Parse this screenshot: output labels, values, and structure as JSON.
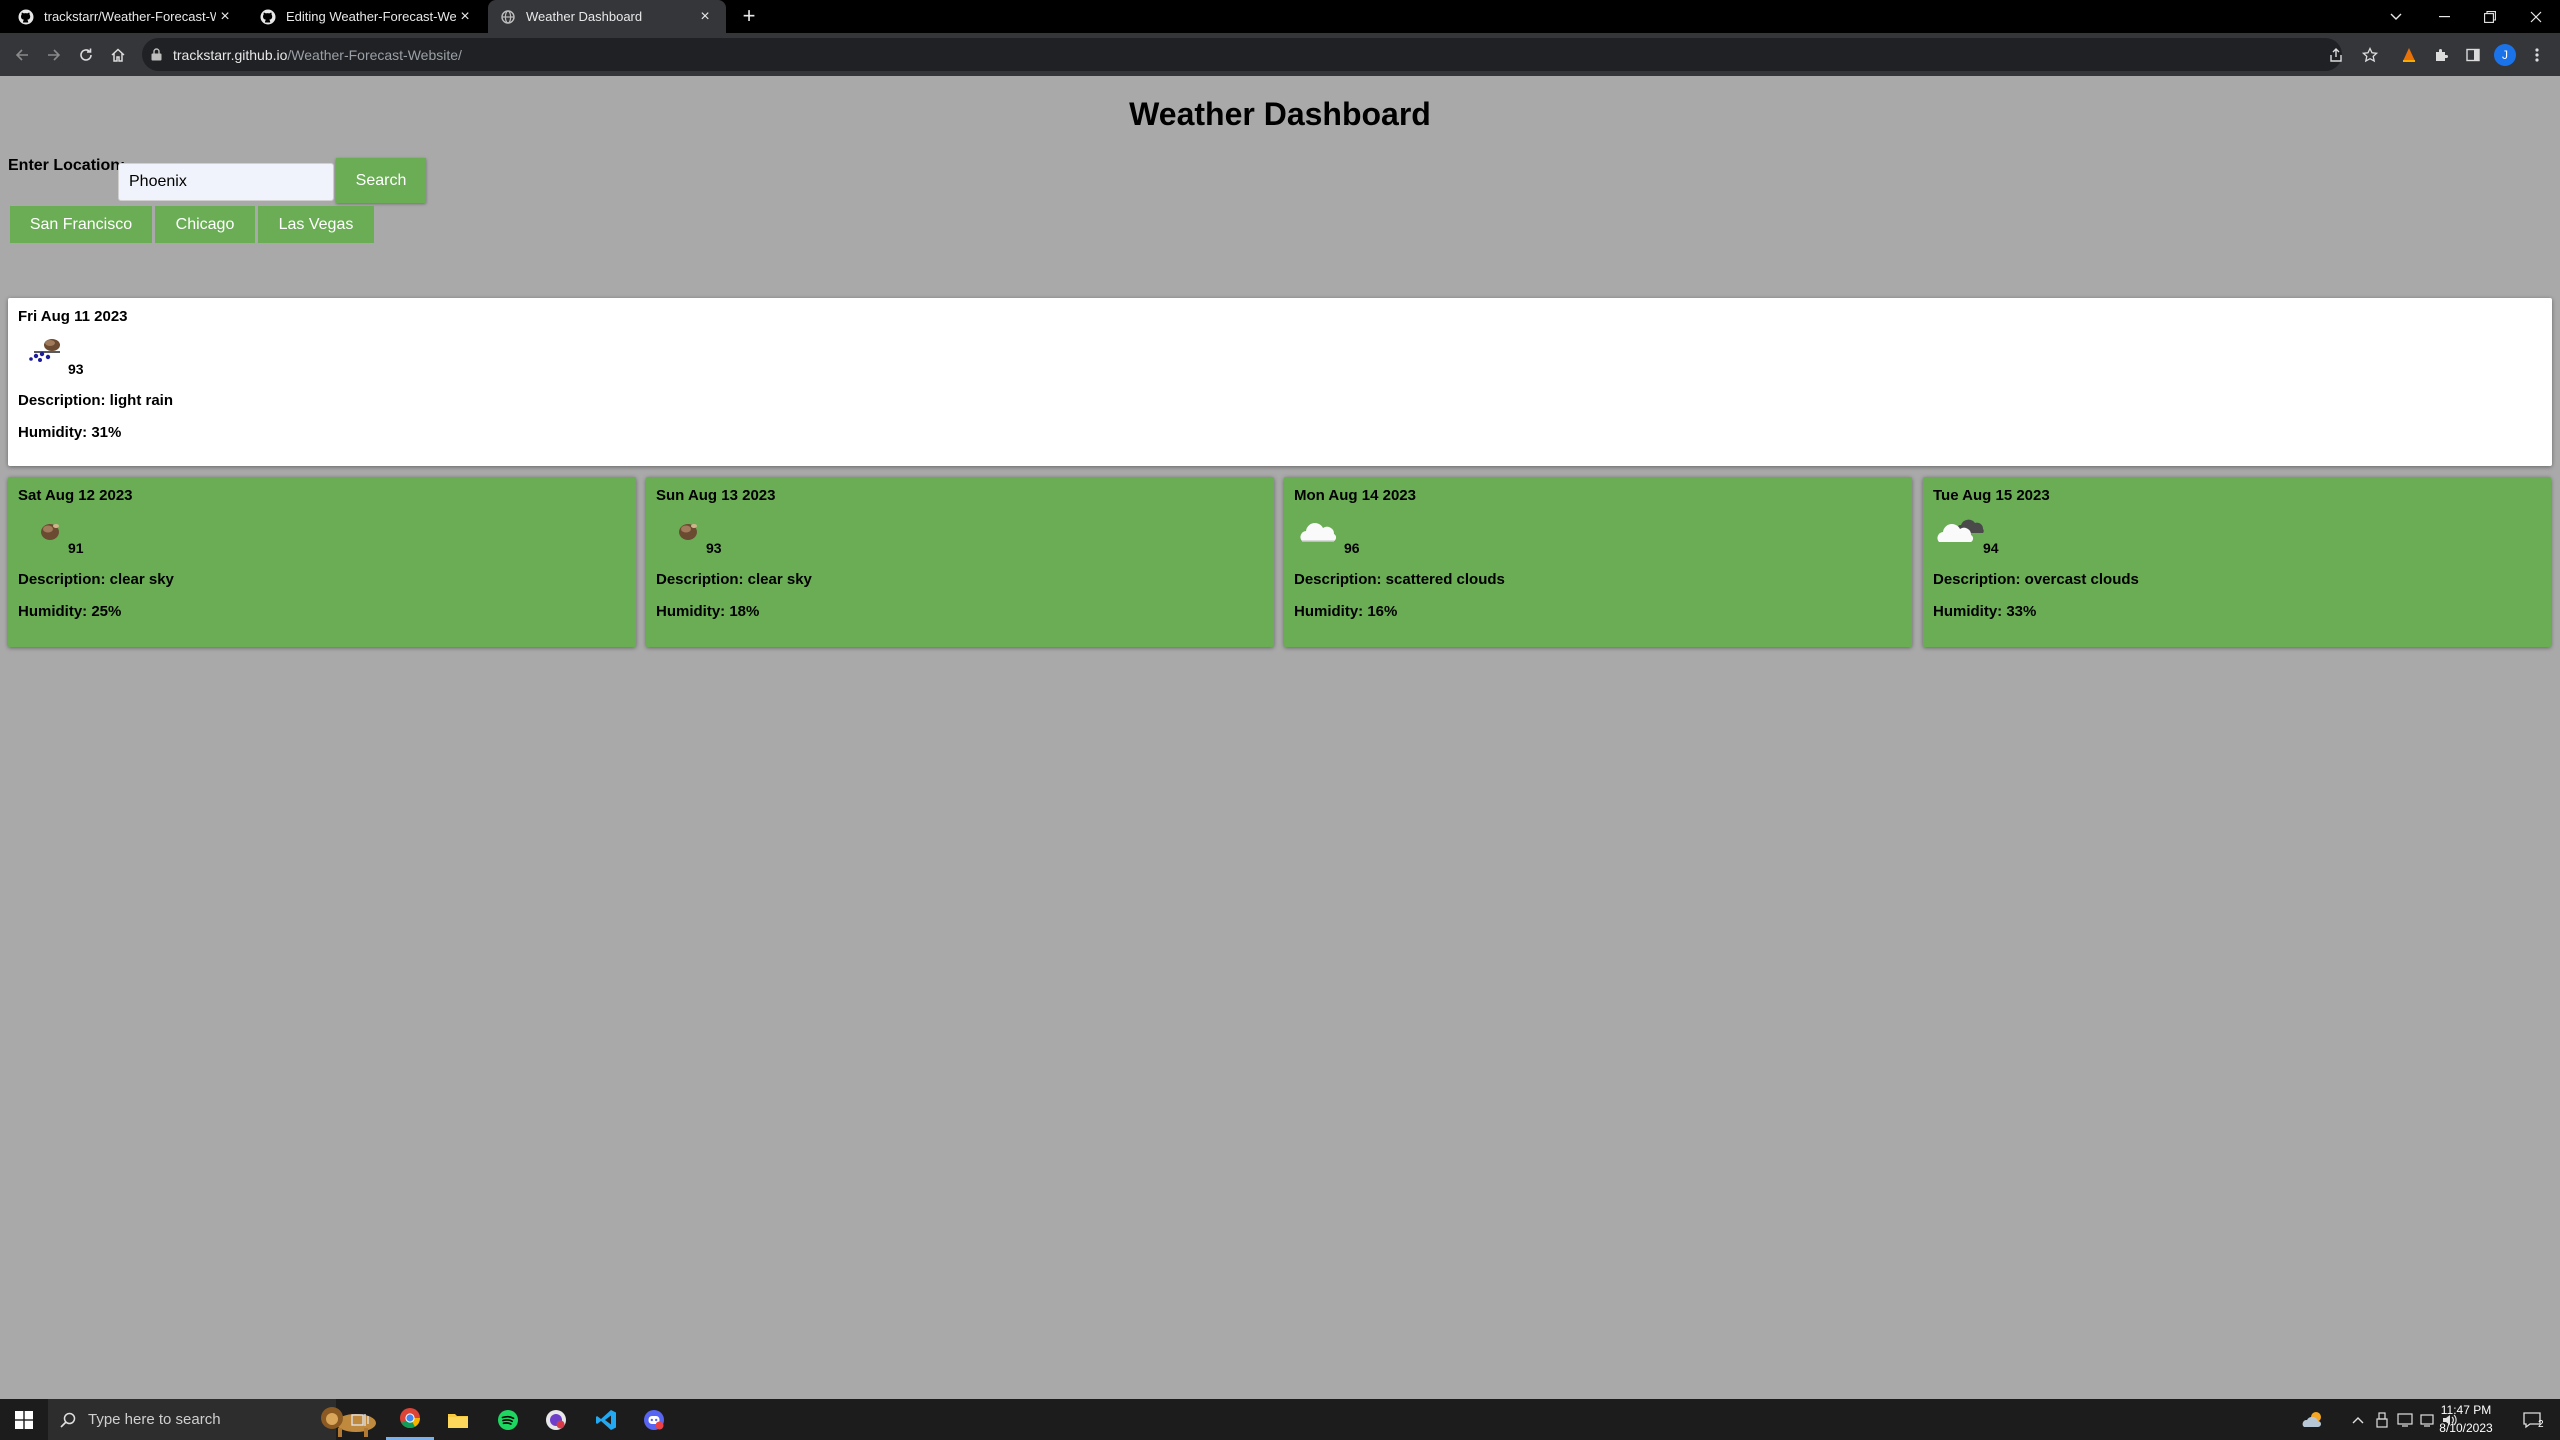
{
  "browser": {
    "tabs": [
      {
        "title": "trackstarr/Weather-Forecast-Website",
        "icon": "github-icon"
      },
      {
        "title": "Editing Weather-Forecast-Website",
        "icon": "github-icon"
      },
      {
        "title": "Weather Dashboard",
        "icon": "globe-icon"
      }
    ],
    "url_host": "trackstarr.github.io",
    "url_path": "/Weather-Forecast-Website/",
    "profile_initial": "J"
  },
  "page": {
    "title": "Weather Dashboard",
    "location_label": "Enter Location:",
    "location_value": "Phoenix",
    "search_label": "Search",
    "recent_cities": [
      "San Francisco",
      "Chicago",
      "Las Vegas"
    ]
  },
  "today": {
    "date": "Fri Aug 11 2023",
    "icon": "light-rain-icon",
    "temp": "93",
    "description": "Description: light rain",
    "humidity": "Humidity: 31%"
  },
  "forecast": [
    {
      "date": "Sat Aug 12 2023",
      "icon": "clear-sky-icon",
      "temp": "91",
      "description": "Description: clear sky",
      "humidity": "Humidity: 25%"
    },
    {
      "date": "Sun Aug 13 2023",
      "icon": "clear-sky-icon",
      "temp": "93",
      "description": "Description: clear sky",
      "humidity": "Humidity: 18%"
    },
    {
      "date": "Mon Aug 14 2023",
      "icon": "scattered-clouds-icon",
      "temp": "96",
      "description": "Description: scattered clouds",
      "humidity": "Humidity: 16%"
    },
    {
      "date": "Tue Aug 15 2023",
      "icon": "overcast-clouds-icon",
      "temp": "94",
      "description": "Description: overcast clouds",
      "humidity": "Humidity: 33%"
    }
  ],
  "taskbar": {
    "search_placeholder": "Type here to search",
    "time": "11:47 PM",
    "date": "8/10/2023",
    "notification_count": "2"
  },
  "colors": {
    "accent_green": "#6aad55",
    "page_background": "#a9a9a9"
  }
}
